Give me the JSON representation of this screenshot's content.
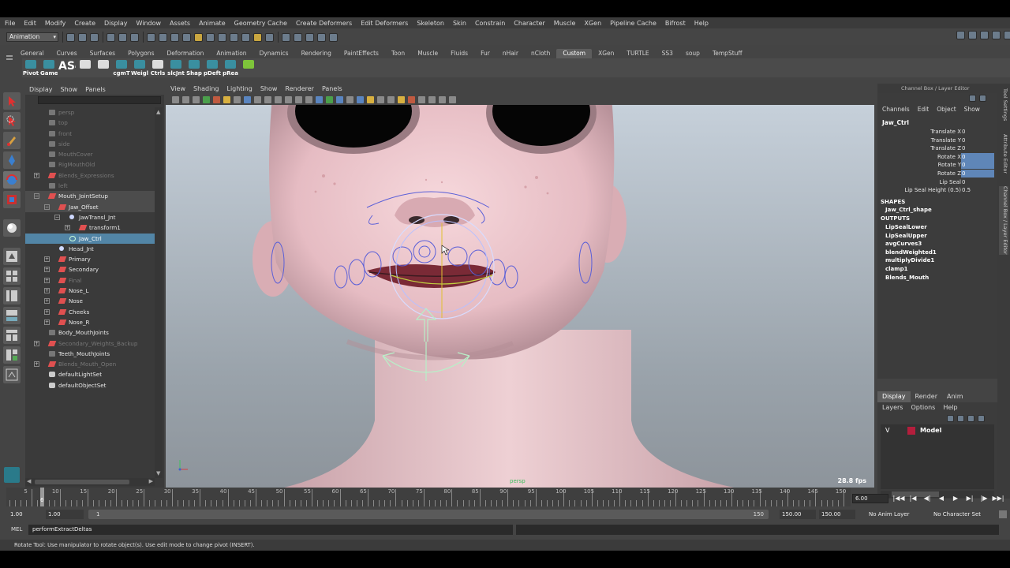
{
  "menubar": [
    "File",
    "Edit",
    "Modify",
    "Create",
    "Display",
    "Window",
    "Assets",
    "Animate",
    "Geometry Cache",
    "Create Deformers",
    "Edit Deformers",
    "Skeleton",
    "Skin",
    "Constrain",
    "Character",
    "Muscle",
    "XGen",
    "Pipeline Cache",
    "Bifrost",
    "Help"
  ],
  "statusline": {
    "menuset": "Animation"
  },
  "shelf": {
    "tabs": [
      "General",
      "Curves",
      "Surfaces",
      "Polygons",
      "Deformation",
      "Animation",
      "Dynamics",
      "Rendering",
      "PaintEffects",
      "Toon",
      "Muscle",
      "Fluids",
      "Fur",
      "nHair",
      "nCloth",
      "Custom",
      "XGen",
      "TURTLE",
      "SS3",
      "soup",
      "TempStuff"
    ],
    "active_tab": "Custom",
    "buttons": [
      "Pivot",
      "Game",
      "AS4",
      "",
      "",
      "cgmT",
      "Weigl",
      "Ctrls",
      "slcJnt",
      "Shap",
      "pDeft",
      "pRea",
      ""
    ]
  },
  "outliner": {
    "menu": [
      "Display",
      "Show",
      "Panels"
    ],
    "items": [
      {
        "label": "persp",
        "indent": 0,
        "icon": "cam",
        "dim": true
      },
      {
        "label": "top",
        "indent": 0,
        "icon": "cam",
        "dim": true
      },
      {
        "label": "front",
        "indent": 0,
        "icon": "cam",
        "dim": true
      },
      {
        "label": "side",
        "indent": 0,
        "icon": "cam",
        "dim": true
      },
      {
        "label": "MouthCover",
        "indent": 0,
        "icon": "cam",
        "dim": true
      },
      {
        "label": "RigMouthOld",
        "indent": 0,
        "icon": "cam",
        "dim": true
      },
      {
        "label": "Blends_Expressions",
        "indent": 0,
        "icon": "grp",
        "dim": true,
        "exp": "+"
      },
      {
        "label": "left",
        "indent": 0,
        "icon": "cam",
        "dim": true
      },
      {
        "label": "Mouth_JointSetup",
        "indent": 0,
        "icon": "grp",
        "exp": "−",
        "hl": true
      },
      {
        "label": "Jaw_Offset",
        "indent": 1,
        "icon": "grp",
        "exp": "−",
        "hl": true
      },
      {
        "label": "JawTransl_Jnt",
        "indent": 2,
        "icon": "jnt",
        "exp": "−"
      },
      {
        "label": "transform1",
        "indent": 3,
        "icon": "grp",
        "exp": "+"
      },
      {
        "label": "Jaw_Ctrl",
        "indent": 2,
        "icon": "crv",
        "sel": true
      },
      {
        "label": "Head_Jnt",
        "indent": 1,
        "icon": "jnt"
      },
      {
        "label": "Primary",
        "indent": 1,
        "icon": "grp",
        "exp": "+"
      },
      {
        "label": "Secondary",
        "indent": 1,
        "icon": "grp",
        "exp": "+"
      },
      {
        "label": "Final",
        "indent": 1,
        "icon": "grp",
        "exp": "+",
        "dim": true
      },
      {
        "label": "Nose_L",
        "indent": 1,
        "icon": "grp",
        "exp": "+"
      },
      {
        "label": "Nose",
        "indent": 1,
        "icon": "grp",
        "exp": "+"
      },
      {
        "label": "Cheeks",
        "indent": 1,
        "icon": "grp",
        "exp": "+"
      },
      {
        "label": "Nose_R",
        "indent": 1,
        "icon": "grp",
        "exp": "+"
      },
      {
        "label": "Body_MouthJoints",
        "indent": 0,
        "icon": "cam"
      },
      {
        "label": "Secondary_Weights_Backup",
        "indent": 0,
        "icon": "grp",
        "dim": true,
        "exp": "+"
      },
      {
        "label": "Teeth_MouthJoints",
        "indent": 0,
        "icon": "cam"
      },
      {
        "label": "Blends_Mouth_Open",
        "indent": 0,
        "icon": "grp",
        "dim": true,
        "exp": "+"
      },
      {
        "label": "defaultLightSet",
        "indent": 0,
        "icon": "set"
      },
      {
        "label": "defaultObjectSet",
        "indent": 0,
        "icon": "set"
      }
    ]
  },
  "viewport": {
    "menu": [
      "View",
      "Shading",
      "Lighting",
      "Show",
      "Renderer",
      "Panels"
    ],
    "fps": "28.8 fps",
    "camera": "persp"
  },
  "channelbox": {
    "title": "Channel Box / Layer Editor",
    "menu": [
      "Channels",
      "Edit",
      "Object",
      "Show"
    ],
    "node": "Jaw_Ctrl",
    "attributes": [
      {
        "name": "Translate X",
        "value": "0",
        "sel": false
      },
      {
        "name": "Translate Y",
        "value": "0",
        "sel": false
      },
      {
        "name": "Translate Z",
        "value": "0",
        "sel": false
      },
      {
        "name": "Rotate X",
        "value": "0",
        "sel": true
      },
      {
        "name": "Rotate Y",
        "value": "0",
        "sel": true
      },
      {
        "name": "Rotate Z",
        "value": "0",
        "sel": true
      },
      {
        "name": "Lip Seal",
        "value": "0",
        "sel": false
      },
      {
        "name": "Lip Seal Height (0.5)",
        "value": "0.5",
        "sel": false
      }
    ],
    "shapes_header": "SHAPES",
    "shapes": [
      "Jaw_Ctrl_shape"
    ],
    "outputs_header": "OUTPUTS",
    "outputs": [
      "LipSealLower",
      "LipSealUpper",
      "avgCurves3",
      "blendWeighted1",
      "multiplyDivide1",
      "clamp1",
      "Blends_Mouth"
    ]
  },
  "layereditor": {
    "tabs": [
      "Display",
      "Render",
      "Anim"
    ],
    "active_tab": "Display",
    "menu": [
      "Layers",
      "Options",
      "Help"
    ],
    "layer": {
      "visible": "V",
      "name": "Model",
      "color": "#b41e3c"
    }
  },
  "sidetabs": [
    "Tool Settings",
    "Attribute Editor",
    "Channel Box / Layer Editor"
  ],
  "timeslider": {
    "ticks": [
      5,
      10,
      15,
      20,
      25,
      30,
      35,
      40,
      45,
      50,
      55,
      60,
      65,
      70,
      75,
      80,
      85,
      90,
      95,
      100,
      105,
      110,
      115,
      120,
      125,
      130,
      135,
      140,
      145,
      150
    ],
    "current_frame": "6",
    "frame_field": "6.00",
    "playback": [
      "|◀◀",
      "|◀",
      "◀|",
      "◀",
      "▶",
      "▶|",
      "|▶",
      "▶▶|"
    ]
  },
  "range": {
    "start": "1.00",
    "start_inner": "1.00",
    "bar_start": "1",
    "bar_end": "150",
    "end_inner": "150.00",
    "end": "150.00",
    "anim_layer": "No Anim Layer",
    "char_set": "No Character Set"
  },
  "cmdline": {
    "label": "MEL",
    "value": "performExtractDeltas"
  },
  "helpline": "Rotate Tool: Use manipulator to rotate object(s). Use edit mode to change pivot (INSERT)."
}
